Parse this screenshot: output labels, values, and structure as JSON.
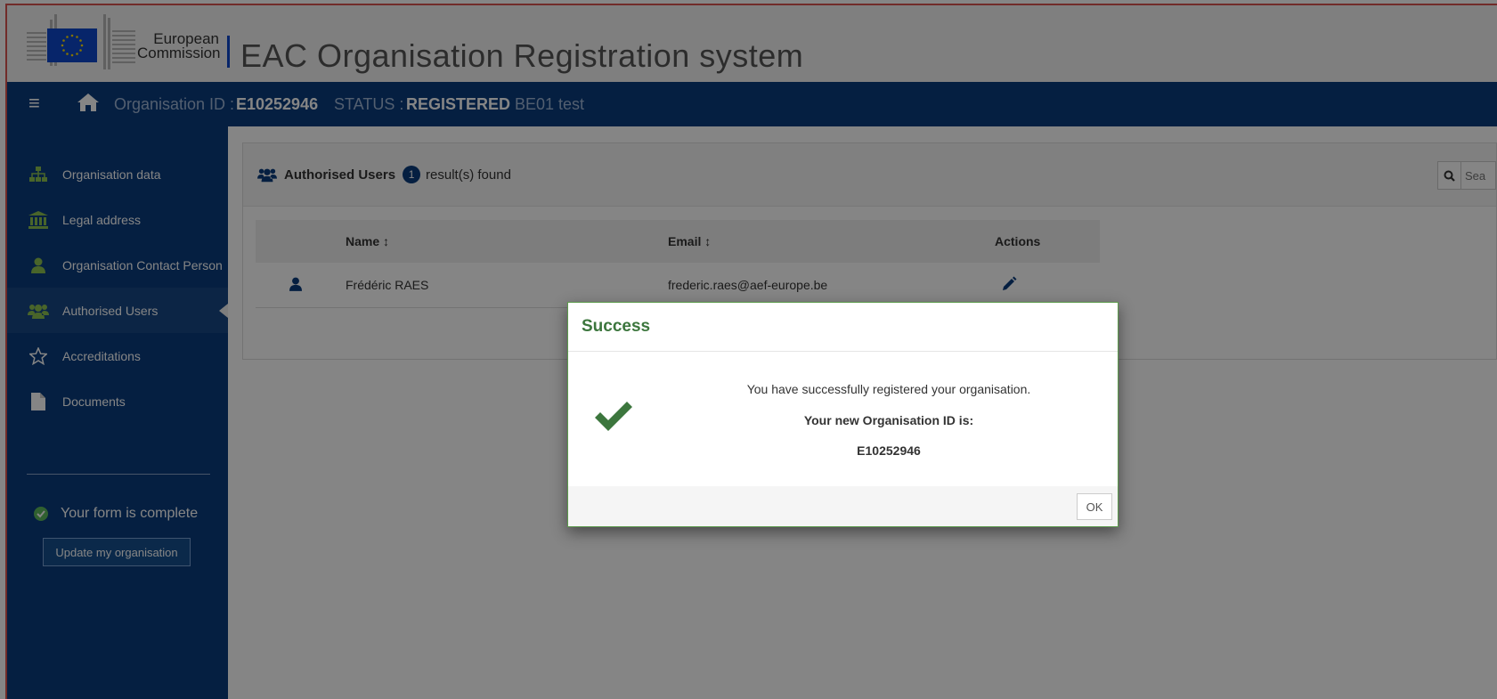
{
  "header": {
    "logo_line1": "European",
    "logo_line2": "Commission",
    "app_title": "EAC Organisation Registration system"
  },
  "topbar": {
    "org_id_label": "Organisation ID :",
    "org_id_value": "E10252946",
    "status_label": "STATUS :",
    "status_value": "REGISTERED",
    "org_name": "BE01 test"
  },
  "sidebar": {
    "items": [
      {
        "label": "Organisation data",
        "icon": "sitemap-icon"
      },
      {
        "label": "Legal address",
        "icon": "bank-icon"
      },
      {
        "label": "Organisation Contact Person",
        "icon": "user-icon"
      },
      {
        "label": "Authorised Users",
        "icon": "users-icon",
        "active": true
      },
      {
        "label": "Accreditations",
        "icon": "star-icon"
      },
      {
        "label": "Documents",
        "icon": "file-icon"
      }
    ],
    "form_status": "Your form is complete",
    "update_button": "Update my organisation"
  },
  "panel": {
    "title": "Authorised Users",
    "count": "1",
    "result_text": "result(s) found",
    "search_placeholder": "Sea"
  },
  "table": {
    "headers": [
      "Name ↕",
      "Email ↕",
      "Actions"
    ],
    "rows": [
      {
        "name": "Frédéric RAES",
        "email": "frederic.raes@aef-europe.be"
      }
    ]
  },
  "modal": {
    "title": "Success",
    "line1": "You have successfully registered your organisation.",
    "line2": "Your new Organisation ID is:",
    "line3": "E10252946",
    "ok_button": "OK"
  },
  "colors": {
    "brand_blue": "#0b3d7e",
    "success_green": "#3c763d"
  }
}
